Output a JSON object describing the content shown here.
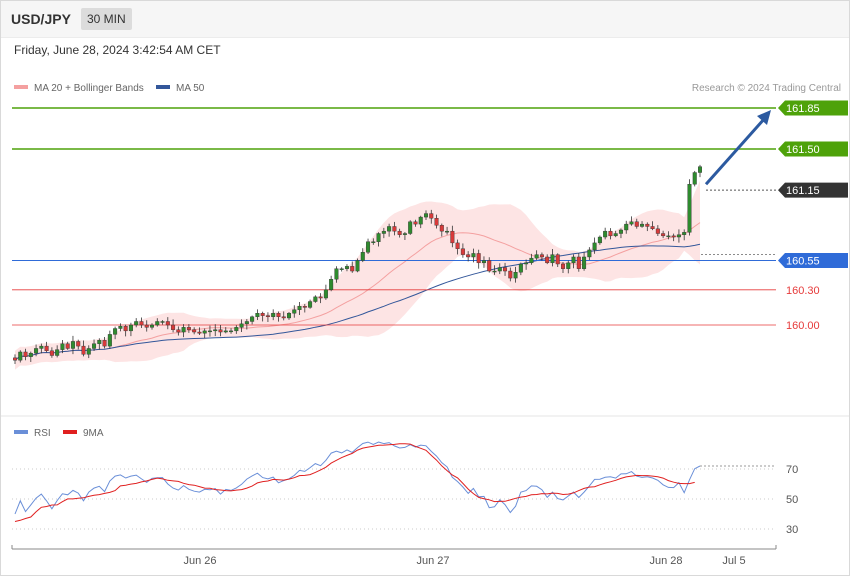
{
  "header": {
    "symbol": "USD/JPY",
    "timeframe": "30 MIN"
  },
  "datetime": "Friday, June 28, 2024 3:42:54 AM CET",
  "credit": "Research © 2024 Trading Central",
  "colors": {
    "resistance": "#4ea20a",
    "pivot": "#2f6bd8",
    "support": "#e63a3a",
    "current": "#333333",
    "bull": "#2e8b2e",
    "bear": "#d83a3a",
    "band": "#fde4e4",
    "ma20": "#f4a0a0",
    "ma50": "#33579a",
    "rsi": "#6a8fd8",
    "rsi_ma": "#e02020",
    "arrow": "#2c5aa0"
  },
  "chart_data": [
    {
      "type": "line",
      "subtype": "candlestick",
      "legend": [
        {
          "name": "MA 20 + Bollinger Bands",
          "color": "#f4a0a0"
        },
        {
          "name": "MA 50",
          "color": "#33579a"
        }
      ],
      "ylim": [
        159.7,
        161.95
      ],
      "levels": [
        {
          "value": 161.85,
          "label": "161.85",
          "kind": "resistance"
        },
        {
          "value": 161.5,
          "label": "161.50",
          "kind": "resistance"
        },
        {
          "value": 161.15,
          "label": "161.15",
          "kind": "current"
        },
        {
          "value": 160.55,
          "label": "160.55",
          "kind": "pivot"
        },
        {
          "value": 160.3,
          "label": "160.30",
          "kind": "support"
        },
        {
          "value": 160.0,
          "label": "160.00",
          "kind": "support"
        }
      ],
      "x_ticks": [
        "Jun 26",
        "Jun 27",
        "Jun 28",
        "Jul 5"
      ],
      "close": [
        159.7,
        159.77,
        159.73,
        159.76,
        159.8,
        159.82,
        159.78,
        159.74,
        159.79,
        159.84,
        159.8,
        159.86,
        159.82,
        159.75,
        159.8,
        159.84,
        159.87,
        159.82,
        159.92,
        159.97,
        159.99,
        159.95,
        160.0,
        160.03,
        160.0,
        159.98,
        160.0,
        160.03,
        160.03,
        160.0,
        159.96,
        159.94,
        159.98,
        159.96,
        159.94,
        159.93,
        159.95,
        159.95,
        159.96,
        159.94,
        159.95,
        159.95,
        159.98,
        160.01,
        160.03,
        160.07,
        160.1,
        160.08,
        160.07,
        160.1,
        160.07,
        160.06,
        160.1,
        160.13,
        160.16,
        160.15,
        160.2,
        160.24,
        160.23,
        160.3,
        160.39,
        160.48,
        160.48,
        160.5,
        160.46,
        160.55,
        160.62,
        160.71,
        160.71,
        160.78,
        160.8,
        160.84,
        160.8,
        160.77,
        160.78,
        160.88,
        160.86,
        160.92,
        160.95,
        160.91,
        160.85,
        160.8,
        160.8,
        160.7,
        160.65,
        160.6,
        160.58,
        160.61,
        160.53,
        160.55,
        160.46,
        160.46,
        160.49,
        160.46,
        160.4,
        160.45,
        160.52,
        160.53,
        160.57,
        160.6,
        160.58,
        160.53,
        160.6,
        160.52,
        160.48,
        160.53,
        160.58,
        160.48,
        160.58,
        160.64,
        160.7,
        160.75,
        160.8,
        160.76,
        160.78,
        160.81,
        160.86,
        160.88,
        160.84,
        160.86,
        160.84,
        160.82,
        160.78,
        160.76,
        160.76,
        160.75,
        160.77,
        160.79,
        161.2,
        161.3,
        161.35
      ],
      "rsi": {
        "legend": [
          {
            "name": "RSI",
            "color": "#6a8fd8"
          },
          {
            "name": "9MA",
            "color": "#e02020"
          }
        ],
        "ylim": [
          20,
          100
        ],
        "ticks": [
          70,
          50,
          30
        ],
        "rsi_values": [
          40.0,
          48.8,
          41.6,
          46.1,
          50.6,
          53.3,
          48.7,
          43.5,
          49.0,
          53.5,
          52.8,
          55.7,
          53.9,
          48.8,
          54.6,
          57.3,
          58.5,
          54.9,
          62.0,
          65.3,
          66.1,
          64.0,
          65.3,
          65.9,
          63.4,
          61.1,
          63.7,
          64.2,
          64.3,
          60.0,
          57.3,
          55.9,
          58.9,
          56.5,
          55.2,
          54.6,
          56.5,
          56.2,
          56.9,
          53.3,
          56.4,
          55.7,
          57.4,
          59.8,
          63.3,
          65.4,
          67.2,
          64.3,
          63.4,
          64.6,
          60.8,
          62.3,
          63.5,
          65.7,
          69.1,
          68.4,
          70.9,
          73.6,
          72.2,
          75.8,
          80.6,
          81.9,
          80.7,
          82.7,
          81.1,
          84.3,
          87.0,
          87.9,
          86.4,
          88.0,
          86.9,
          87.6,
          85.4,
          84.0,
          84.4,
          86.2,
          84.6,
          85.9,
          85.5,
          81.7,
          78.6,
          74.2,
          71.4,
          64.5,
          61.6,
          58.0,
          53.7,
          57.1,
          51.5,
          51.7,
          44.2,
          44.8,
          49.5,
          46.3,
          41.0,
          45.2,
          54.6,
          55.6,
          58.7,
          58.5,
          56.2,
          51.1,
          54.6,
          50.3,
          49.4,
          52.0,
          54.6,
          51.0,
          54.6,
          58.6,
          63.1,
          63.2,
          64.5,
          64.8,
          63.9,
          66.7,
          66.8,
          68.3,
          65.2,
          64.4,
          64.8,
          64.0,
          62.5,
          59.5,
          57.7,
          57.6,
          60.9,
          54.2,
          62.8,
          70.2,
          72.0
        ],
        "ma_values": [
          35.0,
          35.8,
          37.0,
          38.0,
          41.5,
          44.5,
          45.0,
          46.0,
          46.1,
          48.2,
          50.1,
          50.1,
          50.5,
          50.8,
          51.7,
          52.5,
          52.9,
          53.7,
          54.4,
          55.6,
          58.7,
          59.2,
          59.9,
          60.4,
          61.4,
          62.1,
          63.1,
          63.9,
          63.4,
          62.5,
          62.1,
          61.7,
          60.5,
          59.6,
          59.2,
          58.3,
          57.3,
          57.2,
          56.3,
          56.0,
          55.6,
          55.4,
          55.9,
          56.3,
          57.3,
          58.6,
          60.7,
          61.6,
          62.0,
          63.1,
          62.8,
          62.6,
          63.3,
          64.2,
          65.6,
          65.7,
          66.3,
          67.7,
          69.4,
          71.2,
          73.9,
          75.8,
          77.6,
          79.1,
          80.4,
          82.6,
          83.9,
          84.6,
          85.2,
          85.8,
          85.9,
          86.2,
          86.4,
          86.8,
          86.8,
          86.6,
          85.1,
          83.8,
          82.5,
          79.1,
          75.9,
          72.1,
          68.9,
          66.0,
          64.1,
          60.4,
          56.6,
          53.6,
          51.1,
          50.2,
          49.5,
          48.3,
          48.4,
          48.5,
          49.4,
          50.5,
          51.3,
          51.7,
          52.8,
          53.0,
          53.6,
          53.4,
          53.9,
          53.7,
          53.0,
          53.3,
          54.1,
          55.6,
          57.1,
          57.9,
          58.2,
          59.5,
          60.6,
          61.5,
          62.5,
          63.7,
          64.7,
          65.3,
          65.7,
          65.6,
          65.6,
          65.3,
          64.8,
          63.9,
          62.3,
          61.2,
          60.4,
          60.3,
          60.3,
          61.1
        ]
      }
    }
  ]
}
